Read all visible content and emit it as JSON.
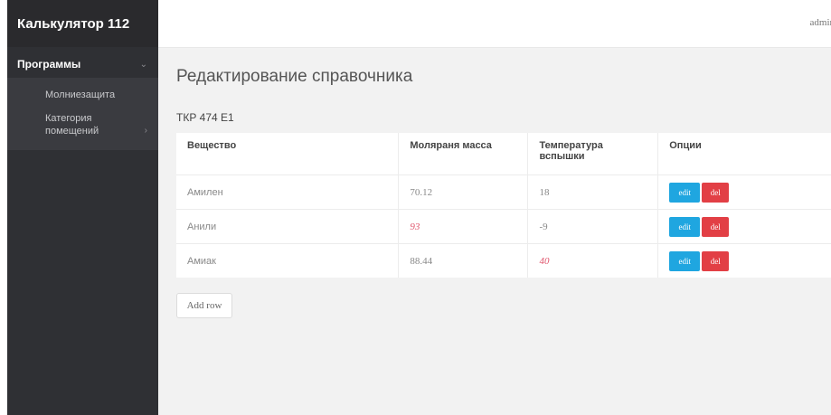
{
  "app": {
    "brand": "Калькулятор 112",
    "user": "admin"
  },
  "sidebar": {
    "group_label": "Программы",
    "items": [
      {
        "label": "Молниезащита"
      },
      {
        "label": "Категория помещений"
      }
    ]
  },
  "page": {
    "title": "Редактирование справочника",
    "subtitle": "ТКР 474 Е1"
  },
  "table": {
    "headers": [
      "Вещество",
      "Моляраня масса",
      "Температура вспышки",
      "Опции"
    ],
    "rows": [
      {
        "substance": "Амилен",
        "molar_mass": "70.12",
        "flash_point": "18"
      },
      {
        "substance": "Анили",
        "molar_mass": "93",
        "flash_point": "-9"
      },
      {
        "substance": "Амиак",
        "molar_mass": "88.44",
        "flash_point": "40"
      }
    ],
    "edit_label": "edit",
    "del_label": "del"
  },
  "actions": {
    "add_row_label": "Add row"
  },
  "colors": {
    "sidebar": "#2f3034",
    "edit": "#1fa6e0",
    "del": "#e23f45",
    "highlight": "#e0576e"
  },
  "icons": {
    "collapse": "chevron-down-icon",
    "submenu": "chevron-right-icon"
  }
}
